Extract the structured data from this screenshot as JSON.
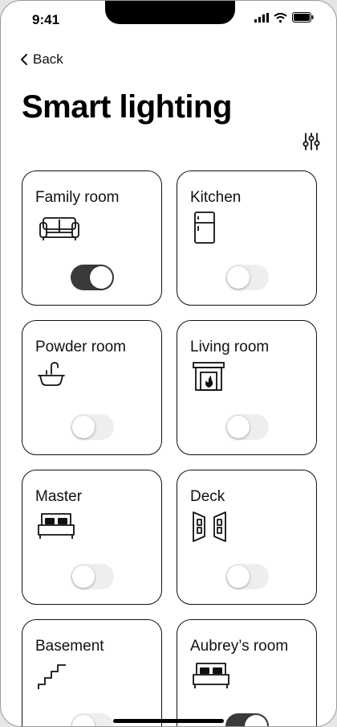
{
  "status_bar": {
    "time": "9:41",
    "icons": [
      "signal-icon",
      "wifi-icon",
      "battery-icon"
    ]
  },
  "nav": {
    "back_label": "Back"
  },
  "header": {
    "title": "Smart lighting",
    "filter_icon": "sliders-icon"
  },
  "rooms": [
    {
      "label": "Family room",
      "icon": "sofa-icon",
      "light_on": true
    },
    {
      "label": "Kitchen",
      "icon": "fridge-icon",
      "light_on": false
    },
    {
      "label": "Powder room",
      "icon": "sink-icon",
      "light_on": false
    },
    {
      "label": "Living room",
      "icon": "fireplace-icon",
      "light_on": false
    },
    {
      "label": "Master",
      "icon": "bed-icon",
      "light_on": false
    },
    {
      "label": "Deck",
      "icon": "doors-icon",
      "light_on": false
    },
    {
      "label": "Basement",
      "icon": "stairs-icon",
      "light_on": false
    },
    {
      "label": "Aubrey’s room",
      "icon": "bed-icon",
      "light_on": true
    }
  ],
  "colors": {
    "toggle_on": "#3a3a3a",
    "toggle_off": "#eeeeee",
    "card_border": "#111111"
  }
}
